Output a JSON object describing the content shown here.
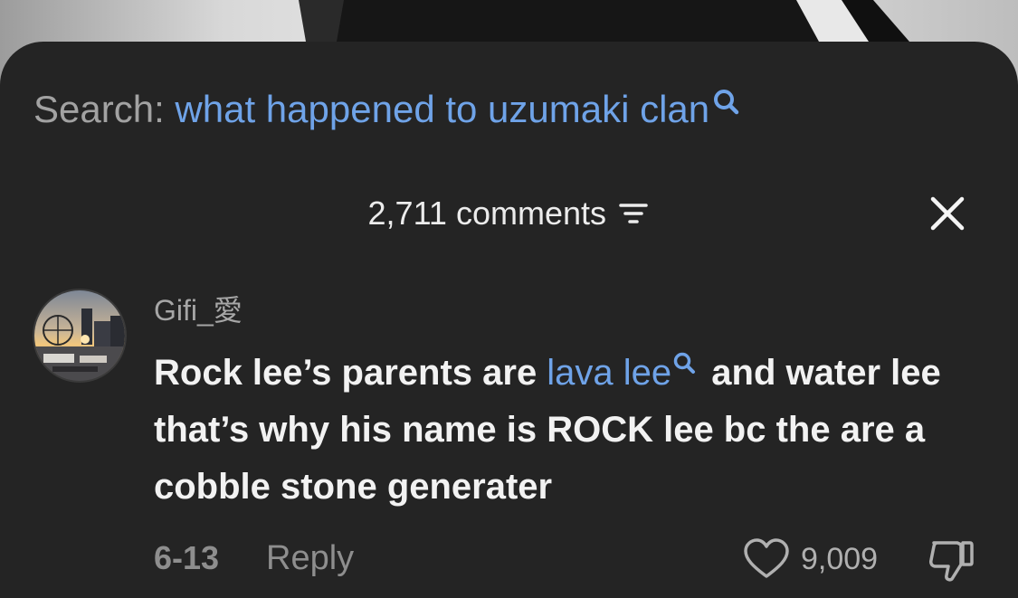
{
  "search": {
    "prefix": "Search:",
    "query": "what happened to uzumaki clan",
    "icon": "search-icon"
  },
  "comments_header": {
    "count_label": "2,711 comments",
    "sort_icon": "sort-icon",
    "close_icon": "close-icon"
  },
  "comment": {
    "username": "Gifi_愛",
    "text_before_link": "Rock lee’s parents are ",
    "link_text": "lava lee",
    "text_after_link": " and water lee that’s why his name is ROCK lee bc the are a cobble stone generater",
    "date": "6-13",
    "reply_label": "Reply",
    "like_count": "9,009",
    "like_icon": "heart-icon",
    "dislike_icon": "thumbs-down-icon"
  },
  "colors": {
    "sheet_background": "#242424",
    "link_blue": "#6fa3e8",
    "primary_text": "#f2f2f2",
    "secondary_text": "#8e8e8e"
  }
}
